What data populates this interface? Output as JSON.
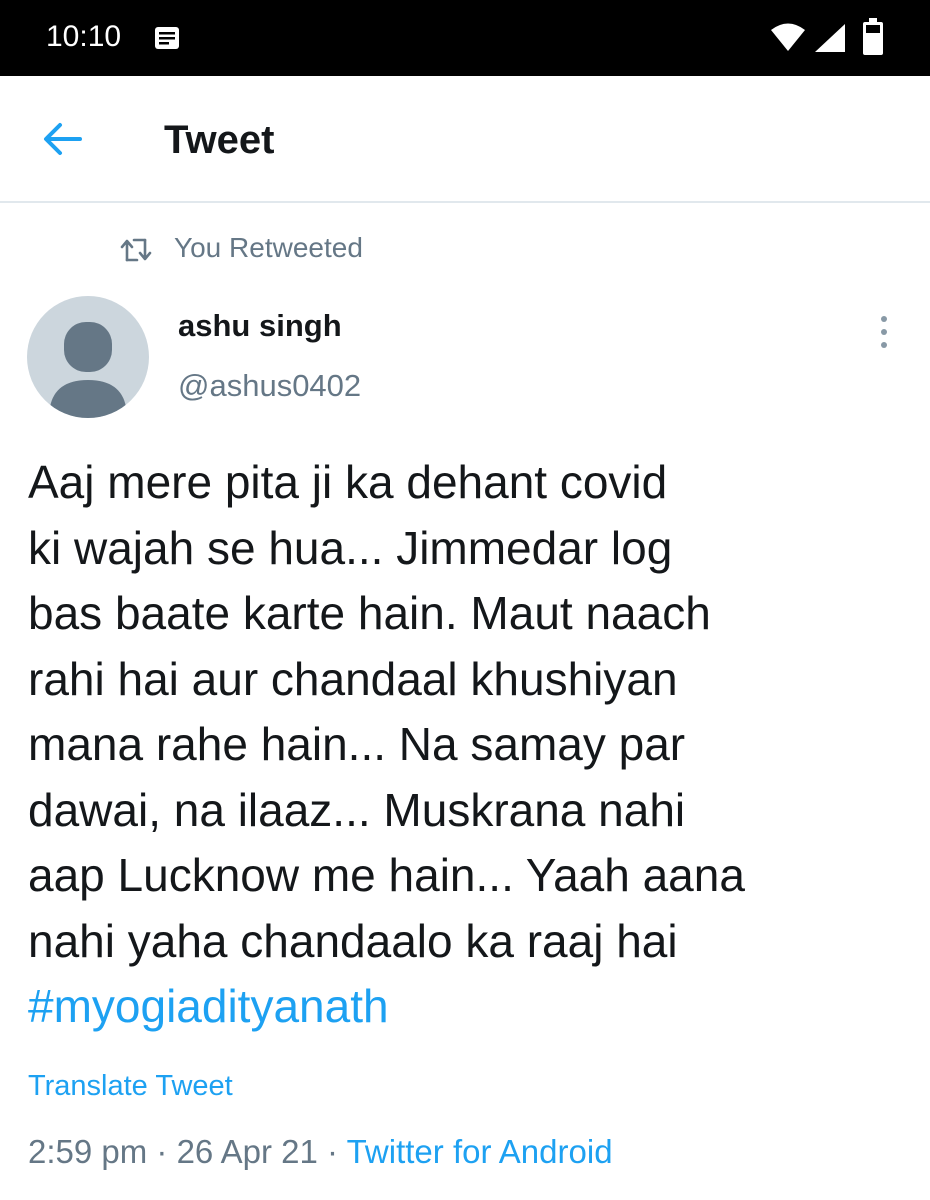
{
  "status_bar": {
    "time": "10:10",
    "icons": [
      "notification-icon",
      "wifi-icon",
      "signal-icon",
      "battery-icon"
    ]
  },
  "header": {
    "back_icon": "arrow-left-icon",
    "title": "Tweet"
  },
  "retweet": {
    "icon": "retweet-icon",
    "label": "You Retweeted"
  },
  "author": {
    "name": "ashu singh",
    "handle": "@ashus0402",
    "avatar_icon": "default-avatar-icon",
    "more_icon": "more-vertical-icon"
  },
  "tweet": {
    "lines": [
      "Aaj mere pita ji ka dehant covid",
      "ki wajah se hua... Jimmedar log",
      "bas baate karte hain. Maut naach",
      "rahi hai aur chandaal khushiyan",
      "mana rahe hain... Na samay par",
      "dawai, na ilaaz... Muskrana nahi",
      "aap Lucknow me hain... Yaah aana",
      "nahi yaha chandaalo ka raaj hai"
    ],
    "hashtag": "#myogiadityanath"
  },
  "translate_label": "Translate Tweet",
  "meta": {
    "time": "2:59 pm",
    "separator": " · ",
    "date": "26 Apr 21",
    "source": "Twitter for Android"
  },
  "colors": {
    "accent": "#1da1f2",
    "text_primary": "#14171a",
    "text_secondary": "#657786",
    "divider": "#e1e8ed",
    "avatar_bg": "#ccd6dd",
    "avatar_fg": "#657786"
  }
}
